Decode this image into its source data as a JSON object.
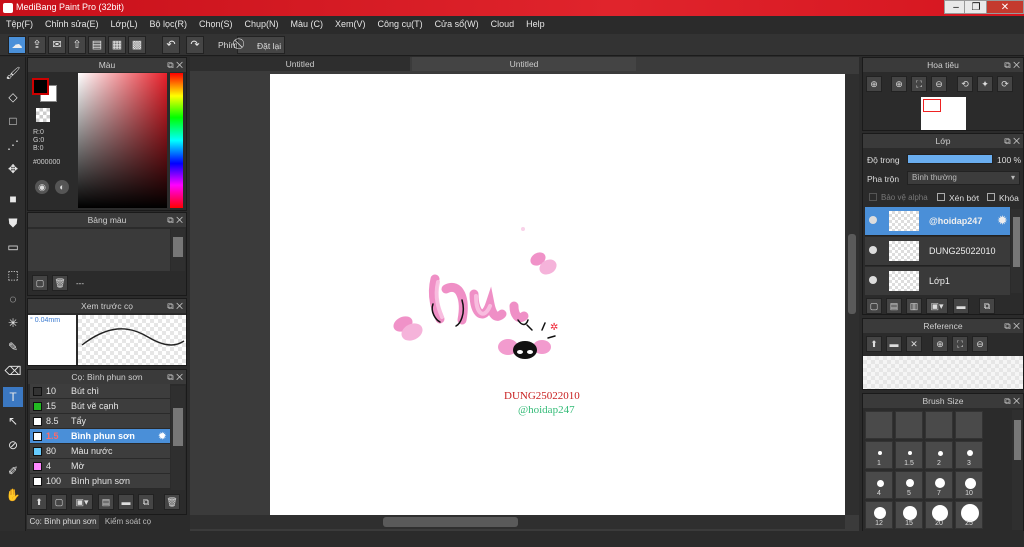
{
  "window": {
    "title": "MediBang Paint Pro (32bit)"
  },
  "menu": [
    "Tệp(F)",
    "Chỉnh sửa(E)",
    "Lớp(L)",
    "Bộ lọc(R)",
    "Chọn(S)",
    "Chụp(N)",
    "Màu (C)",
    "Xem(V)",
    "Công cụ(T)",
    "Cửa sổ(W)",
    "Cloud",
    "Help"
  ],
  "toolbar": {
    "key_label": "Phím",
    "reset_label": "Đặt lại"
  },
  "color_panel": {
    "title": "Màu",
    "r": "R:0",
    "g": "G:0",
    "b": "B:0",
    "hex": "#000000"
  },
  "palette_panel": {
    "title": "Bảng màu",
    "placeholder": "---"
  },
  "brush_preview": {
    "title": "Xem trước cọ",
    "size": "0.04mm"
  },
  "brush_panel": {
    "title": "Cọ: Bình phun sơn",
    "items": [
      {
        "size": "10",
        "name": "Bút chì",
        "color": "#333333"
      },
      {
        "size": "15",
        "name": "Bút vẽ cạnh",
        "color": "#22bb22"
      },
      {
        "size": "8.5",
        "name": "Tẩy",
        "color": "#ffffff"
      },
      {
        "size": "1.5",
        "name": "Bình phun sơn",
        "color": "#ffffff",
        "selected": true
      },
      {
        "size": "80",
        "name": "Màu nước",
        "color": "#66ccff"
      },
      {
        "size": "4",
        "name": "Mờ",
        "color": "#ff88ff"
      },
      {
        "size": "100",
        "name": "Bình phun sơn",
        "color": "#ffffff"
      }
    ],
    "tab1": "Cọ: Bình phun sơn",
    "tab2": "Kiểm soát cọ"
  },
  "tabs": [
    "Untitled",
    "Untitled"
  ],
  "canvas": {
    "text1": "DUNG25022010",
    "text2": "@hoidap247"
  },
  "navigator": {
    "title": "Hoa tiêu"
  },
  "layer_panel": {
    "title": "Lớp",
    "opacity_label": "Độ trong",
    "opacity_value": "100 %",
    "blend_label": "Pha trộn",
    "blend_value": "Bình thường",
    "protect_alpha": "Bảo vệ alpha",
    "clip": "Xén bớt",
    "lock": "Khóa",
    "layers": [
      {
        "name": "@hoidap247",
        "selected": true
      },
      {
        "name": "DUNG25022010"
      },
      {
        "name": "Lớp1"
      }
    ]
  },
  "reference": {
    "title": "Reference"
  },
  "brush_size": {
    "title": "Brush Size",
    "sizes": [
      "",
      "",
      "",
      "",
      "1",
      "1.5",
      "2",
      "3",
      "4",
      "5",
      "7",
      "10",
      "12",
      "15",
      "20",
      "25"
    ]
  }
}
